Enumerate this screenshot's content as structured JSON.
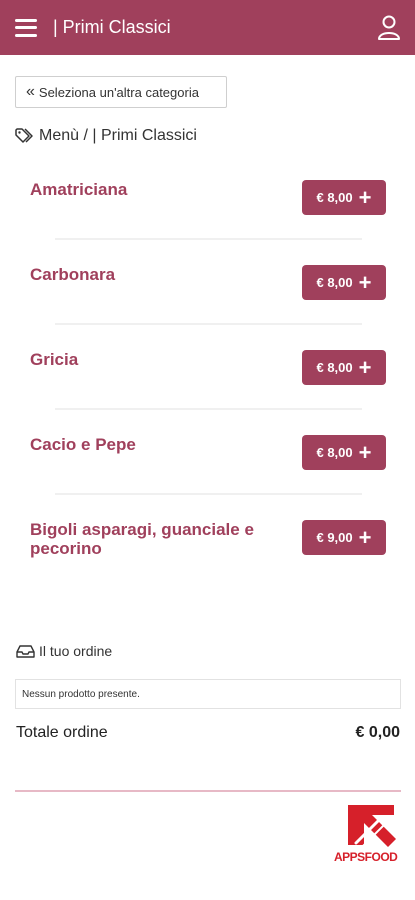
{
  "header": {
    "title": "| Primi Classici"
  },
  "back_button": {
    "label": "Seleziona un'altra categoria"
  },
  "breadcrumb": {
    "text": "Menù / | Primi Classici"
  },
  "products": [
    {
      "name": "Amatriciana",
      "price": "€ 8,00"
    },
    {
      "name": "Carbonara",
      "price": "€ 8,00"
    },
    {
      "name": "Gricia",
      "price": "€ 8,00"
    },
    {
      "name": "Cacio e Pepe",
      "price": "€ 8,00"
    },
    {
      "name": "Bigoli asparagi, guanciale e pecorino",
      "price": "€ 9,00"
    }
  ],
  "order": {
    "title": "Il tuo ordine",
    "empty_message": "Nessun prodotto presente.",
    "total_label": "Totale ordine",
    "total_value": "€ 0,00"
  },
  "footer": {
    "logo_text": "APPSFOOD"
  },
  "colors": {
    "brand": "#a0405c",
    "logo_red": "#d6202a"
  }
}
